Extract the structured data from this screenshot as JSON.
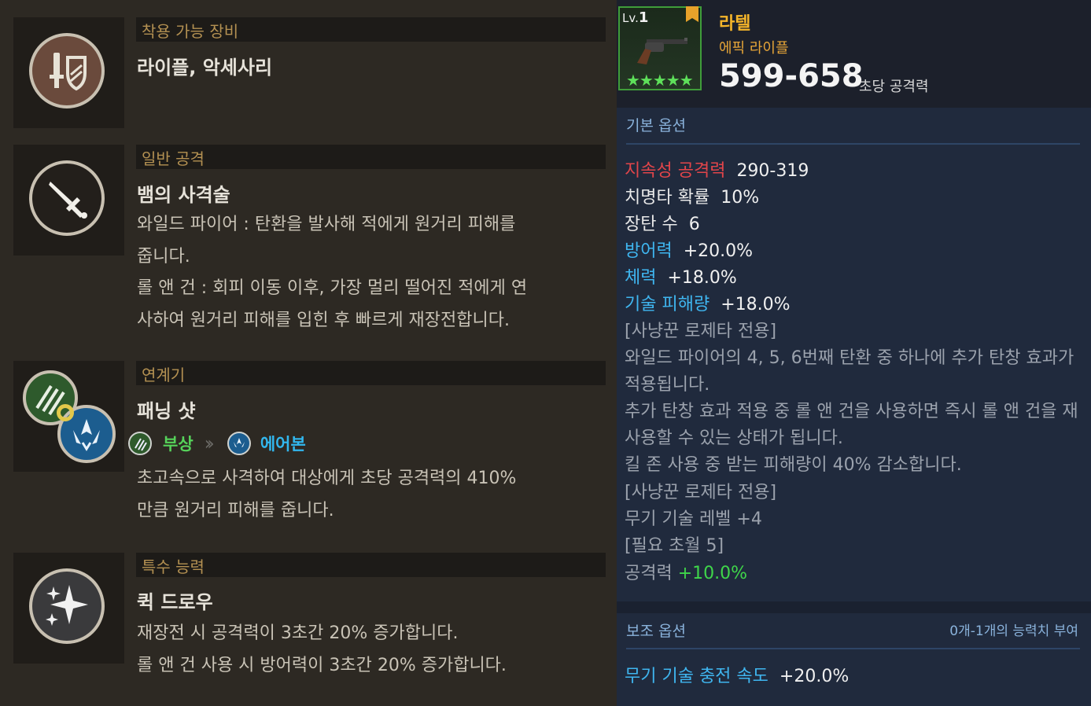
{
  "left": {
    "sections": [
      {
        "header": "착용 가능 장비",
        "title": "라이플, 악세사리",
        "icon": "sword-shield-icon"
      },
      {
        "header": "일반 공격",
        "title": "뱀의 사격술",
        "icon": "dagger-icon",
        "lines": [
          "와일드 파이어 : 탄환을 발사해 적에게 원거리 피해를",
          "줍니다.",
          "롤 앤 건 : 회피 이동 이후, 가장 멀리 떨어진 적에게 연",
          "사하여 원거리 피해를 입힌 후 빠르게 재장전합니다."
        ]
      },
      {
        "header": "연계기",
        "title": "패닝 샷",
        "icon": "claw-chain-icon",
        "chain_from": "부상",
        "chain_to": "에어본",
        "chain_from_color": "#56d25a",
        "chain_to_color": "#32b7ee",
        "lines": [
          "초고속으로 사격하여 대상에게 초당 공격력의 410%",
          "만큼 원거리 피해를 줍니다."
        ]
      },
      {
        "header": "특수 능력",
        "title": "퀵 드로우",
        "icon": "sparkle-icon",
        "lines": [
          "재장전 시 공격력이 3초간 20% 증가합니다.",
          "롤 앤 건 사용 시 방어력이 3초간 20% 증가합니다."
        ]
      }
    ]
  },
  "item": {
    "level_label": "Lv.",
    "level": "1",
    "name": "라텔",
    "type": "에픽 라이플",
    "dps": "599-658",
    "dps_label": "초당 공격력",
    "stars": "★★★★★",
    "name_color": "#f5b52a",
    "type_color": "#e8a638"
  },
  "basic": {
    "title": "기본 옵션",
    "stats": [
      {
        "label": "지속성 공격력",
        "value": "290-319",
        "label_color": "#e2454a"
      },
      {
        "label": "치명타 확률",
        "value": "10%",
        "label_color": "#e9e9e9"
      },
      {
        "label": "장탄 수",
        "value": "6",
        "label_color": "#e9e9e9"
      },
      {
        "label": "방어력",
        "value": "+20.0%",
        "label_color": "#3fb6f0"
      },
      {
        "label": "체력",
        "value": "+18.0%",
        "label_color": "#3fb6f0"
      },
      {
        "label": "기술 피해량",
        "value": "+18.0%",
        "label_color": "#3fb6f0"
      }
    ],
    "notes": [
      "[사냥꾼 로제타 전용]",
      "와일드 파이어의 4, 5, 6번째 탄환 중 하나에 추가 탄창 효과가",
      "적용됩니다.",
      "추가 탄창 효과 적용 중 롤 앤 건을 사용하면 즉시 롤 앤 건을 재",
      "사용할 수 있는 상태가 됩니다.",
      "킬 존 사용 중 받는 피해량이 40% 감소합니다.",
      "[사냥꾼 로제타 전용]",
      "무기 기술 레벨 +4",
      "[필요 초월 5]"
    ],
    "final_label": "공격력",
    "final_value": "+10.0%",
    "final_color": "#3fd64a"
  },
  "sub": {
    "title": "보조 옵션",
    "right_text": "0개-1개의 능력치 부여",
    "stat_label": "무기 기술 충전 속도",
    "stat_value": "+20.0%"
  }
}
